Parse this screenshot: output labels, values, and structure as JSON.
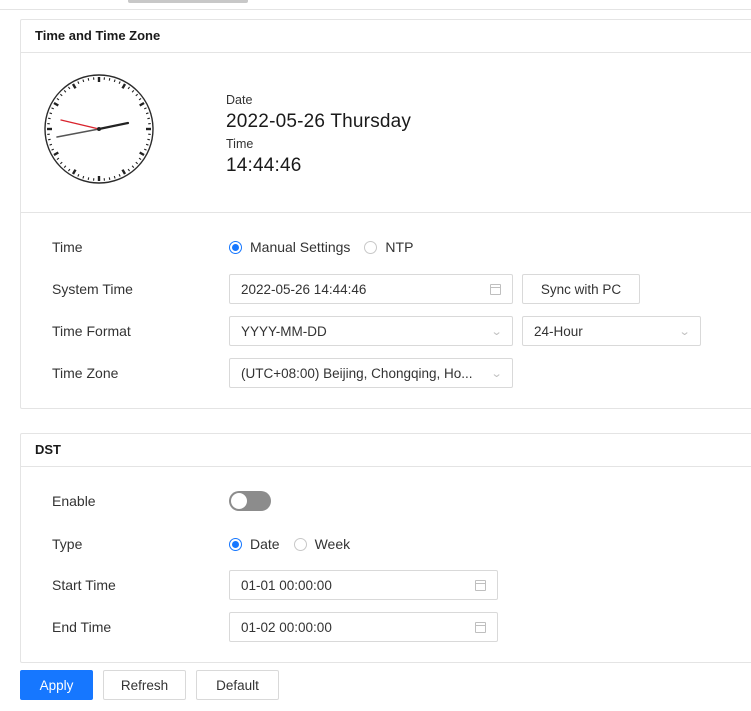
{
  "time_panel": {
    "title": "Time and Time Zone",
    "date_label": "Date",
    "date_value": "2022-05-26 Thursday",
    "time_label": "Time",
    "time_value": "14:44:46",
    "rows": {
      "time_mode": {
        "label": "Time",
        "options": [
          "Manual Settings",
          "NTP"
        ],
        "selected": "Manual Settings"
      },
      "system_time": {
        "label": "System Time",
        "value": "2022-05-26 14:44:46",
        "sync_button": "Sync with PC"
      },
      "time_format": {
        "label": "Time Format",
        "date_format": "YYYY-MM-DD",
        "hour_format": "24-Hour"
      },
      "time_zone": {
        "label": "Time Zone",
        "value": "(UTC+08:00) Beijing, Chongqing, Ho..."
      }
    }
  },
  "dst_panel": {
    "title": "DST",
    "enable": {
      "label": "Enable",
      "on": false
    },
    "type": {
      "label": "Type",
      "options": [
        "Date",
        "Week"
      ],
      "selected": "Date"
    },
    "start_time": {
      "label": "Start Time",
      "value": "01-01 00:00:00"
    },
    "end_time": {
      "label": "End Time",
      "value": "01-02 00:00:00"
    }
  },
  "footer": {
    "apply": "Apply",
    "refresh": "Refresh",
    "default": "Default"
  },
  "colors": {
    "accent": "#1677ff",
    "border": "#e4e4e4",
    "clock_second_hand": "#d9232d"
  }
}
